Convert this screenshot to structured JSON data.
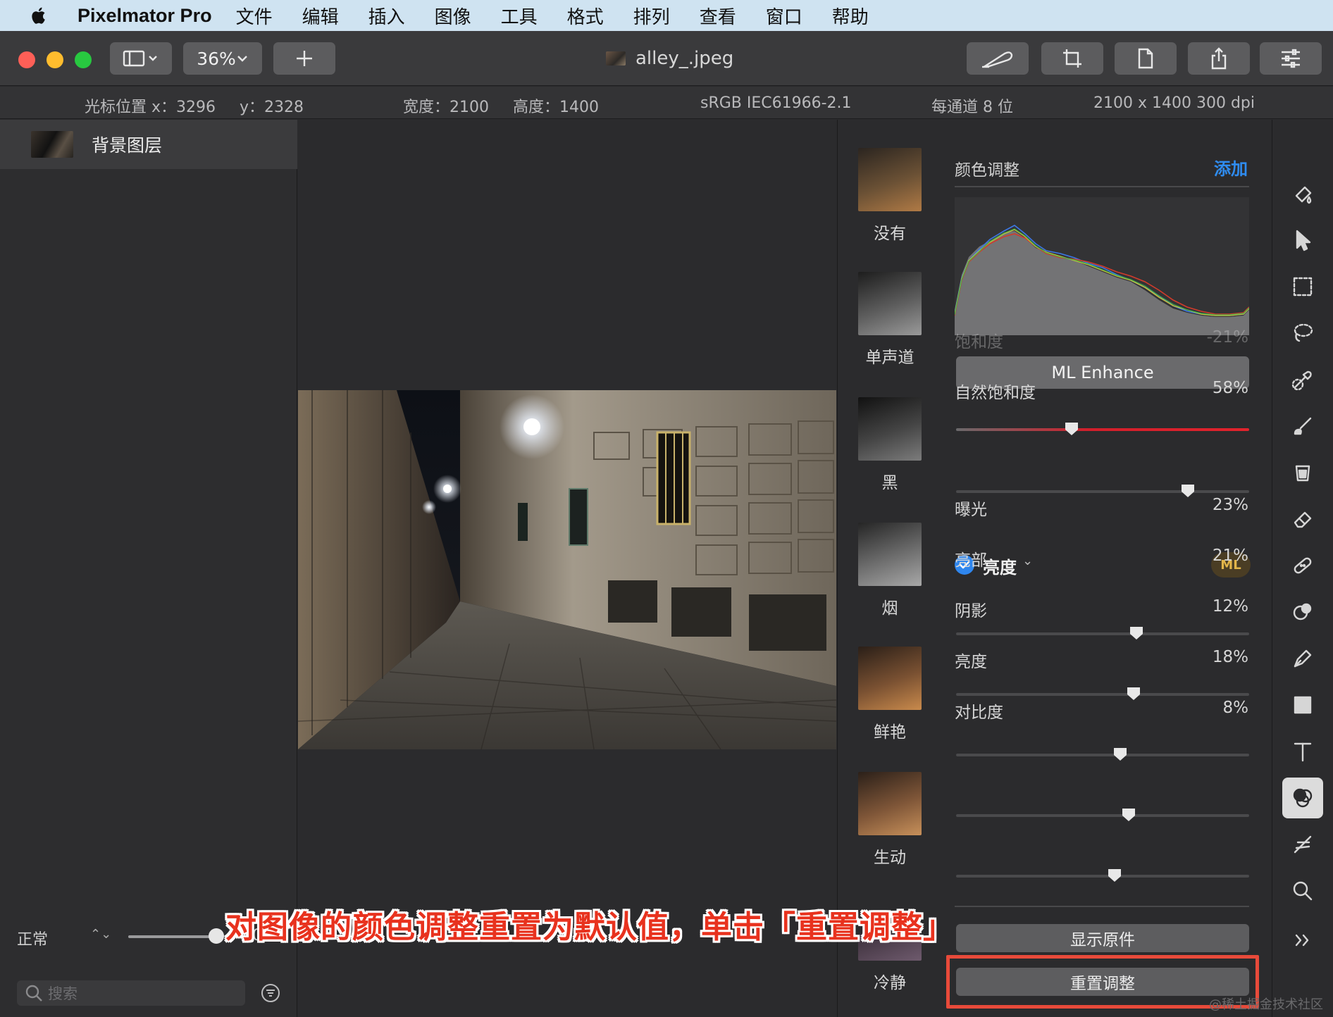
{
  "menubar": {
    "app_name": "Pixelmator Pro",
    "items": [
      "文件",
      "编辑",
      "插入",
      "图像",
      "工具",
      "格式",
      "排列",
      "查看",
      "窗口",
      "帮助"
    ]
  },
  "toolbar": {
    "zoom": "36%",
    "document_title": "alley_.jpeg"
  },
  "infobar": {
    "cursor_x": "光标位置 x：3296",
    "cursor_y": "y：2328",
    "width": "宽度：2100",
    "height": "高度：1400",
    "color_profile": "sRGB IEC61966-2.1",
    "bit_depth": "每通道 8 位",
    "resolution": "2100 x 1400 300 dpi"
  },
  "layers": {
    "layer_name": "背景图层",
    "blend_mode": "正常",
    "opacity": "100%",
    "opacity_value": 1.0,
    "search_placeholder": "搜索"
  },
  "adjustments": {
    "section_title": "颜色调整",
    "add_label": "添加",
    "ml_enhance": "ML Enhance",
    "light_group": "亮度",
    "ml_badge": "ML",
    "show_original": "显示原件",
    "reset": "重置调整",
    "presets": [
      {
        "label": "没有",
        "icon": "warm-thumbnail"
      },
      {
        "label": "单声道",
        "icon": "mono-thumbnail"
      },
      {
        "label": "黑",
        "icon": "black-thumbnail"
      },
      {
        "label": "烟",
        "icon": "smoke-thumbnail"
      },
      {
        "label": "鲜艳",
        "icon": "vivid-thumbnail"
      },
      {
        "label": "生动",
        "icon": "lively-thumbnail"
      },
      {
        "label": "冷静",
        "icon": "calm-thumbnail"
      }
    ],
    "sliders": [
      {
        "label": "饱和度",
        "value": "-21%",
        "level": -0.21
      },
      {
        "label": "自然饱和度",
        "value": "58%",
        "level": 0.58
      },
      {
        "label": "曝光",
        "value": "23%",
        "level": 0.23
      },
      {
        "label": "亮部",
        "value": "21%",
        "level": 0.21
      },
      {
        "label": "阴影",
        "value": "12%",
        "level": 0.12
      },
      {
        "label": "亮度",
        "value": "18%",
        "level": 0.18
      },
      {
        "label": "对比度",
        "value": "8%",
        "level": 0.08
      }
    ]
  },
  "tools": [
    "paint-bucket-icon",
    "arrow-pointer-icon",
    "rect-select-icon",
    "lasso-icon",
    "color-picker-icon",
    "brush-icon",
    "fill-icon",
    "eraser-icon",
    "bandage-icon",
    "clone-icon",
    "pen-icon",
    "shape-icon",
    "text-icon",
    "color-adjust-icon",
    "sparkle-icon",
    "zoom-icon",
    "more-icon"
  ],
  "caption": "对图像的颜色调整重置为默认值，单击「重置调整」",
  "watermark": "@稀土掘金技术社区",
  "colors": {
    "accent": "#2f86ee",
    "highlight": "#e84a3a",
    "menubar": "#cfe3f1"
  }
}
